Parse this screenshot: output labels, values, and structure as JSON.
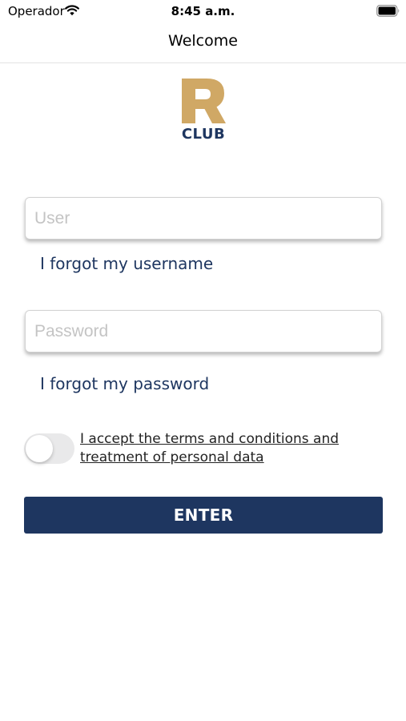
{
  "status_bar": {
    "carrier": "Operador",
    "time": "8:45 a.m.",
    "wifi_icon": "wifi-icon",
    "battery_icon": "battery-icon"
  },
  "nav": {
    "title": "Welcome"
  },
  "logo": {
    "letter": "R",
    "text": "CLUB"
  },
  "user_field": {
    "placeholder": "User",
    "value": ""
  },
  "forgot_username": "I forgot my username",
  "password_field": {
    "placeholder": "Password",
    "value": ""
  },
  "forgot_password": "I forgot my password",
  "terms": {
    "label": "I accept the terms and conditions and treatment of personal data",
    "accepted": false
  },
  "enter_button": "ENTER",
  "colors": {
    "primary": "#1e3660",
    "gold": "#d0a865",
    "toggle_off": "#e9e9ea",
    "placeholder": "#c4c4c4"
  }
}
